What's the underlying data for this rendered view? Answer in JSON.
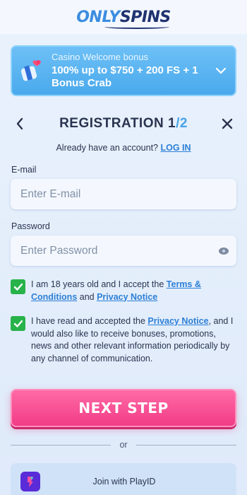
{
  "header": {
    "logo_only": "ONLY",
    "logo_spins": "SPINS"
  },
  "bonus": {
    "kicker": "Casino Welcome bonus",
    "title": "100% up to $750 + 200 FS + 1 Bonus Crab"
  },
  "registration": {
    "title_prefix": "REGISTRATION ",
    "step_current": "1",
    "step_total": "/2",
    "already_text": "Already have an account? ",
    "login_link": "LOG IN"
  },
  "form": {
    "email_label": "E-mail",
    "email_placeholder": "Enter E-mail",
    "password_label": "Password",
    "password_placeholder": "Enter Password"
  },
  "consents": {
    "age": {
      "checked": true,
      "text_1": "I am 18 years old and I accept the ",
      "terms_link": "Terms & Conditions",
      "text_2": " and ",
      "privacy_link": "Privacy Notice"
    },
    "marketing": {
      "checked": true,
      "text_1": "I have read and accepted the ",
      "privacy_link": "Privacy Notice",
      "text_2": ", and I would also like to receive bonuses, promotions, news and other relevant information periodically by any channel of communication."
    }
  },
  "next_button": "NEXT STEP",
  "or_text": "or",
  "playid_label": "Join with PlayID",
  "colors": {
    "accent_blue": "#2c7fd6",
    "bonus_blue": "#4aa9ec",
    "cta_pink": "#f23c86",
    "check_green": "#27b24a",
    "playid_purple": "#5a2bd8"
  }
}
